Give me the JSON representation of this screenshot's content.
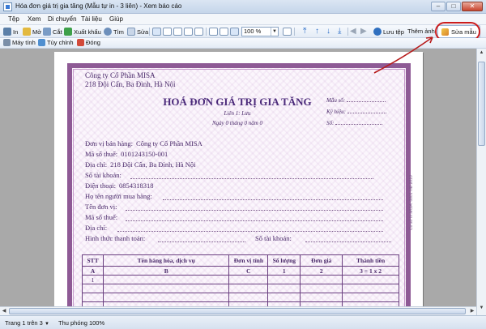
{
  "window": {
    "title": "Hóa đơn giá trị gia tăng (Mẫu tự in - 3 liên) - Xem báo cáo",
    "minimize": "–",
    "maximize": "□",
    "close": "✕"
  },
  "menu": [
    "Tệp",
    "Xem",
    "Di chuyển",
    "Tài liệu",
    "Giúp"
  ],
  "toolbar": {
    "print": "In",
    "open": "Mở",
    "cut": "Cắt",
    "export": "Xuất khẩu",
    "find": "Tìm",
    "edit": "Sửa",
    "zoom_value": "100 %",
    "save_file": "Lưu tệp",
    "add_image": "Thêm ảnh",
    "edit_template": "Sửa mẫu"
  },
  "toolbar2": {
    "calculator": "Máy tính",
    "customize": "Tùy chỉnh",
    "close": "Đóng"
  },
  "invoice": {
    "company": "Công ty Cổ Phần MISA",
    "address": "218 Đội Cấn, Ba Đình, Hà Nội",
    "title": "HOÁ ĐƠN GIÁ TRỊ GIA TĂNG",
    "copy": "Liên 1: Lưu",
    "date": "Ngày 0 tháng 0 năm 0",
    "form_label": "Mẫu số:",
    "symbol_label": "Ký hiệu:",
    "number_label": "Số:",
    "seller_label": "Đơn vị bán hàng:",
    "seller_value": "Công ty Cổ Phần MISA",
    "tax_label": "Mã số thuế:",
    "tax_value": "0101243150-001",
    "addr_label": "Địa chỉ:",
    "addr_value": "218 Đội Cấn, Ba Đình, Hà Nội",
    "account_label": "Số tài khoản:",
    "phone_label": "Điện thoại:",
    "phone_value": "0854318318",
    "buyer_label": "Họ tên người mua hàng:",
    "unit_label": "Tên đơn vị:",
    "buyer_tax_label": "Mã số thuế:",
    "buyer_addr_label": "Địa chỉ:",
    "payment_label": "Hình thức thanh toán:",
    "buyer_account_label": "Số tài khoản:",
    "side_note": "Cơ sở In MISA: 0801 HĐ 2010"
  },
  "table": {
    "headers": [
      "STT",
      "Tên hàng hóa, dịch vụ",
      "Đơn vị tính",
      "Số lượng",
      "Đơn giá",
      "Thành tiền"
    ],
    "codes": [
      "A",
      "B",
      "C",
      "1",
      "2",
      "3 = 1 x 2"
    ],
    "first_row": "1"
  },
  "status": {
    "page": "Trang 1 trên 3",
    "zoom": "Thu phóng 100%"
  }
}
